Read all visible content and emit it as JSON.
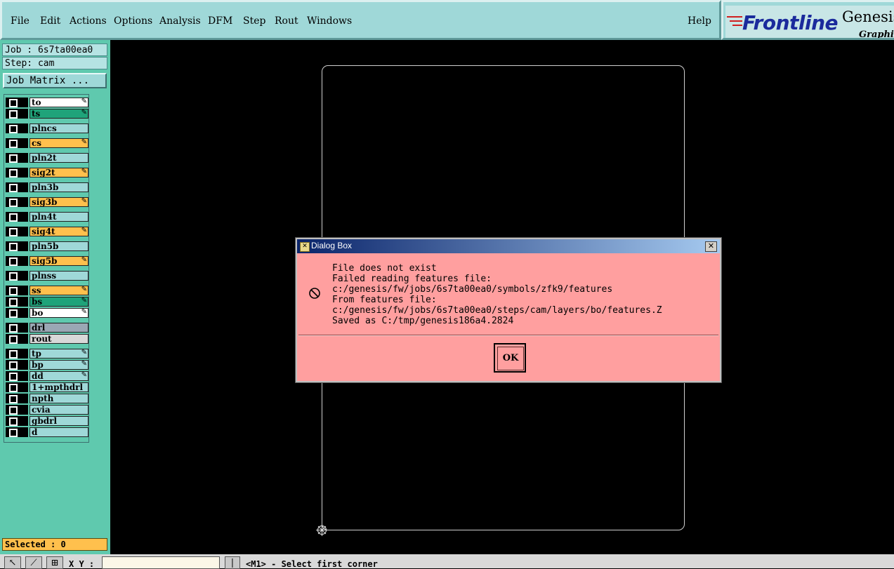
{
  "menubar": {
    "items": [
      {
        "label": "File"
      },
      {
        "label": "Edit"
      },
      {
        "label": "Actions"
      },
      {
        "label": "Options"
      },
      {
        "label": "Analysis"
      },
      {
        "label": "DFM"
      },
      {
        "label": "Step"
      },
      {
        "label": "Rout"
      },
      {
        "label": "Windows"
      }
    ],
    "help": "Help"
  },
  "logo": {
    "brand": "Frontline",
    "product": "Genesis",
    "subtitle": "Graphic"
  },
  "sidebar": {
    "job": "Job : 6s7ta00ea0",
    "step": "Step: cam",
    "job_matrix": "Job Matrix ...",
    "selected": "Selected : 0",
    "layers": [
      {
        "name": "to",
        "color": "#ffffff",
        "editable": true
      },
      {
        "name": "ts",
        "color": "#1fa37a",
        "editable": true
      },
      {
        "name": "plncs",
        "color": "#9fd8d8",
        "editable": false
      },
      {
        "name": "cs",
        "color": "#ffc04d",
        "editable": true
      },
      {
        "name": "pln2t",
        "color": "#9fd8d8",
        "editable": false
      },
      {
        "name": "sig2t",
        "color": "#ffc04d",
        "editable": true
      },
      {
        "name": "pln3b",
        "color": "#9fd8d8",
        "editable": false
      },
      {
        "name": "sig3b",
        "color": "#ffc04d",
        "editable": true
      },
      {
        "name": "pln4t",
        "color": "#9fd8d8",
        "editable": false
      },
      {
        "name": "sig4t",
        "color": "#ffc04d",
        "editable": true
      },
      {
        "name": "pln5b",
        "color": "#9fd8d8",
        "editable": false
      },
      {
        "name": "sig5b",
        "color": "#ffc04d",
        "editable": true
      },
      {
        "name": "plnss",
        "color": "#9fd8d8",
        "editable": false
      },
      {
        "name": "ss",
        "color": "#ffc04d",
        "editable": true
      },
      {
        "name": "bs",
        "color": "#1fa37a",
        "editable": true
      },
      {
        "name": "bo",
        "color": "#ffffff",
        "editable": true
      },
      {
        "name": "drl",
        "color": "#9aa7b4",
        "editable": false
      },
      {
        "name": "rout",
        "color": "#d8d8d8",
        "editable": false
      },
      {
        "name": "tp",
        "color": "#9fd8d8",
        "editable": true
      },
      {
        "name": "bp",
        "color": "#9fd8d8",
        "editable": true
      },
      {
        "name": "dd",
        "color": "#9fd8d8",
        "editable": true
      },
      {
        "name": "1+mpthdrl",
        "color": "#9fd8d8",
        "editable": false
      },
      {
        "name": "npth",
        "color": "#9fd8d8",
        "editable": false
      },
      {
        "name": "cvia",
        "color": "#9fd8d8",
        "editable": false
      },
      {
        "name": "gbdrl",
        "color": "#9fd8d8",
        "editable": false
      },
      {
        "name": "d",
        "color": "#9fd8d8",
        "editable": false
      }
    ]
  },
  "statusbar": {
    "xy_label": "X Y :",
    "xy_value": "",
    "hint": "<M1> - Select first corner",
    "tools": [
      "select-tool-icon",
      "measure-tool-icon",
      "grid-tool-icon"
    ]
  },
  "dialog": {
    "title": "Dialog Box",
    "close": "✕",
    "lines": [
      "File does not exist",
      "Failed reading features file:",
      "c:/genesis/fw/jobs/6s7ta00ea0/symbols/zfk9/features",
      "From features file:",
      "c:/genesis/fw/jobs/6s7ta00ea0/steps/cam/layers/bo/features.Z",
      "Saved as C:/tmp/genesis186a4.2824"
    ],
    "ok": "OK"
  }
}
